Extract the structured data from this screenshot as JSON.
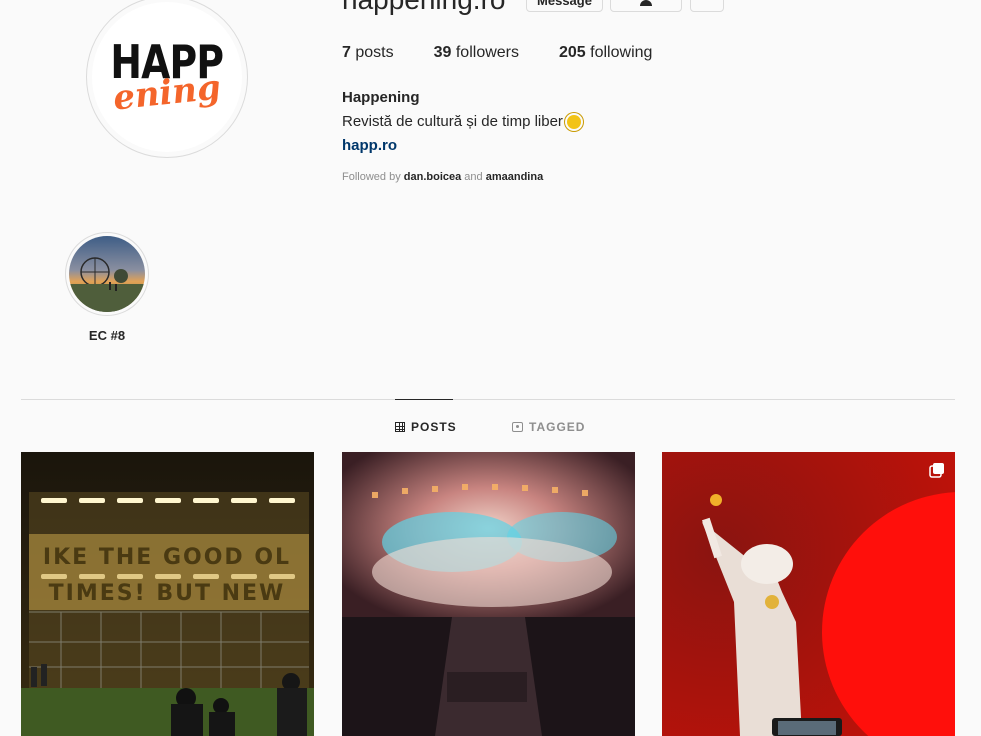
{
  "profile": {
    "username": "happening.ro",
    "buttons": {
      "message": "Message"
    },
    "stats": {
      "posts_count": "7",
      "posts_label": "posts",
      "followers_count": "39",
      "followers_label": "followers",
      "following_count": "205",
      "following_label": "following"
    },
    "full_name": "Happening",
    "bio": "Revistă de cultură și de timp liber",
    "link": "happ.ro",
    "followed_by": {
      "prefix": "Followed by",
      "user1": "dan.boicea",
      "conj": "and",
      "user2": "amaandina"
    },
    "logo": {
      "line1": "HAPP",
      "line2": "ening"
    }
  },
  "highlights": [
    {
      "label": "EC #8"
    }
  ],
  "tabs": {
    "posts": "POSTS",
    "tagged": "TAGGED"
  },
  "post3_banner": {
    "line1": "IKE THE GOOD OL",
    "line2": "TIMES! BUT NEW"
  },
  "colors": {
    "accent_orange": "#f4652b",
    "link": "#00376b",
    "post_red": "#e8160f"
  },
  "icons": [
    "person-follow-icon",
    "more-icon",
    "grid-icon",
    "tag-icon",
    "sun-emoji-icon",
    "multiple-posts-icon"
  ]
}
